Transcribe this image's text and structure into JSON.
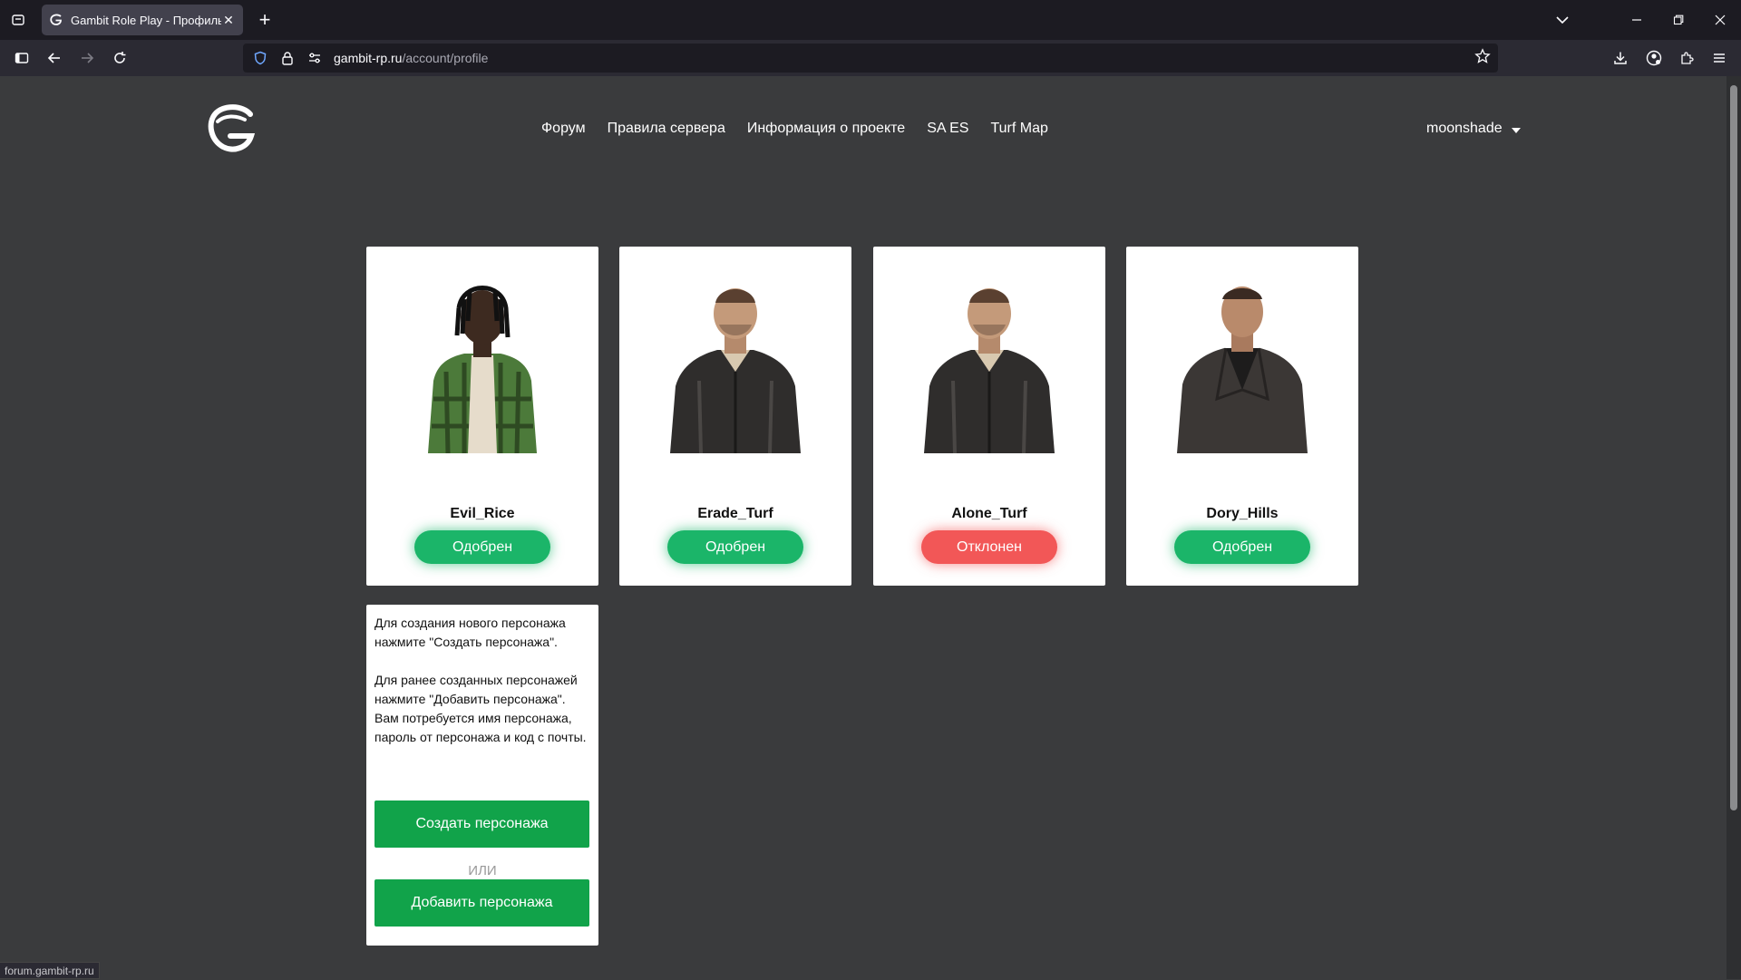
{
  "browser": {
    "tab_title": "Gambit Role Play - Профиль UC",
    "url_host": "gambit-rp.ru",
    "url_path": "/account/profile",
    "status_url": "forum.gambit-rp.ru"
  },
  "site": {
    "nav": [
      "Форум",
      "Правила сервера",
      "Информация о проекте",
      "SA ES",
      "Turf Map"
    ],
    "username": "moonshade"
  },
  "characters": [
    {
      "name": "Evil_Rice",
      "status": "Одобрен",
      "status_type": "approved"
    },
    {
      "name": "Erade_Turf",
      "status": "Одобрен",
      "status_type": "approved"
    },
    {
      "name": "Alone_Turf",
      "status": "Отклонен",
      "status_type": "rejected"
    },
    {
      "name": "Dory_Hills",
      "status": "Одобрен",
      "status_type": "approved"
    }
  ],
  "info": {
    "text": "Для создания нового персонажа нажмите \"Создать персонажа\".\n\nДля ранее созданных персонажей нажмите \"Добавить персонажа\". Вам потребуется имя персонажа, пароль от персонажа и код с почты.",
    "create_label": "Создать персонажа",
    "or_label": "ИЛИ",
    "add_label": "Добавить персонажа"
  },
  "colors": {
    "approved": "#1bb569",
    "rejected": "#f25757",
    "cta": "#11a34a",
    "page_bg": "#3a3b3d"
  }
}
